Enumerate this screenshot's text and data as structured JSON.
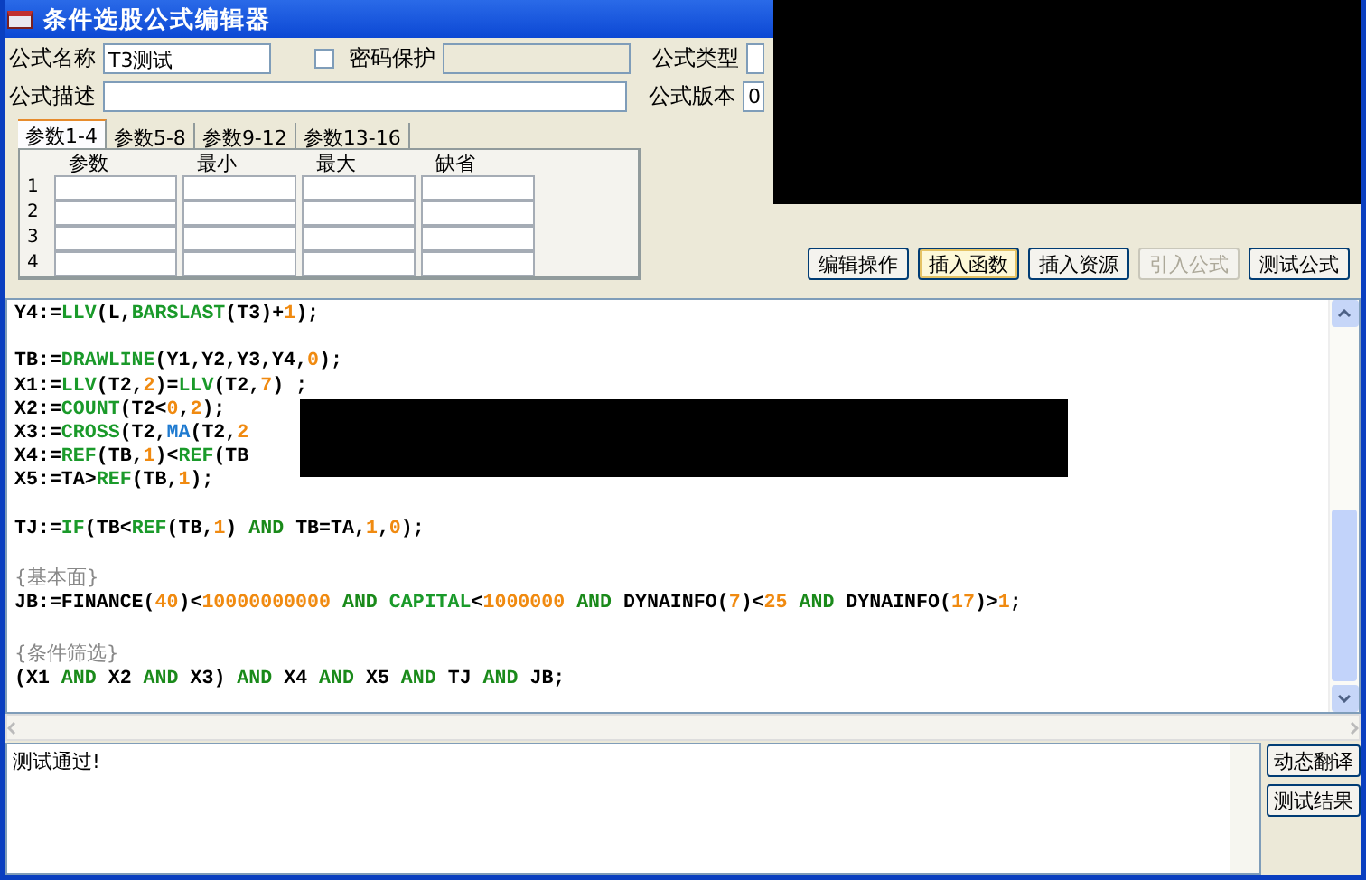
{
  "window": {
    "title": "条件选股公式编辑器"
  },
  "form": {
    "name_label": "公式名称",
    "name_value": "T3测试",
    "password": {
      "label": "密码保护",
      "checked": false
    },
    "type_label": "公式类型",
    "desc_label": "公式描述",
    "version_label": "公式版本",
    "version_value": "0"
  },
  "param_tabs": [
    {
      "label": "参数1-4",
      "selected": true
    },
    {
      "label": "参数5-8",
      "selected": false
    },
    {
      "label": "参数9-12",
      "selected": false
    },
    {
      "label": "参数13-16",
      "selected": false
    }
  ],
  "param_columns": [
    "参数",
    "最小",
    "最大",
    "缺省"
  ],
  "param_rows": [
    "1",
    "2",
    "3",
    "4"
  ],
  "toolbar": [
    {
      "label": "编辑操作",
      "focused": false,
      "disabled": false
    },
    {
      "label": "插入函数",
      "focused": true,
      "disabled": false
    },
    {
      "label": "插入资源",
      "focused": false,
      "disabled": false
    },
    {
      "label": "引入公式",
      "focused": false,
      "disabled": true
    },
    {
      "label": "测试公式",
      "focused": false,
      "disabled": false
    }
  ],
  "code_lines": [
    {
      "gap_before": false,
      "tokens": [
        {
          "kind": "text",
          "text": "Y4:="
        },
        {
          "kind": "func",
          "text": "LLV"
        },
        {
          "kind": "text",
          "text": "(L,"
        },
        {
          "kind": "func",
          "text": "BARSLAST"
        },
        {
          "kind": "text",
          "text": "(T3)+"
        },
        {
          "kind": "num",
          "text": "1"
        },
        {
          "kind": "text",
          "text": ");"
        }
      ]
    },
    {
      "gap_before": true,
      "tokens": [
        {
          "kind": "text",
          "text": "TB:="
        },
        {
          "kind": "func",
          "text": "DRAWLINE"
        },
        {
          "kind": "text",
          "text": "(Y1,Y2,Y3,Y4,"
        },
        {
          "kind": "num",
          "text": "0"
        },
        {
          "kind": "text",
          "text": ");"
        }
      ]
    },
    {
      "gap_before": false,
      "tokens": [
        {
          "kind": "text",
          "text": "X1:="
        },
        {
          "kind": "func",
          "text": "LLV"
        },
        {
          "kind": "text",
          "text": "(T2,"
        },
        {
          "kind": "num",
          "text": "2"
        },
        {
          "kind": "text",
          "text": ")="
        },
        {
          "kind": "func",
          "text": "LLV"
        },
        {
          "kind": "text",
          "text": "(T2,"
        },
        {
          "kind": "num",
          "text": "7"
        },
        {
          "kind": "text",
          "text": ") ;"
        }
      ]
    },
    {
      "gap_before": false,
      "tokens": [
        {
          "kind": "text",
          "text": "X2:="
        },
        {
          "kind": "func",
          "text": "COUNT"
        },
        {
          "kind": "text",
          "text": "(T2<"
        },
        {
          "kind": "num",
          "text": "0"
        },
        {
          "kind": "text",
          "text": ","
        },
        {
          "kind": "num",
          "text": "2"
        },
        {
          "kind": "text",
          "text": ");"
        }
      ]
    },
    {
      "gap_before": false,
      "tokens": [
        {
          "kind": "text",
          "text": "X3:="
        },
        {
          "kind": "func",
          "text": "CROSS"
        },
        {
          "kind": "text",
          "text": "(T2,"
        },
        {
          "kind": "ma",
          "text": "MA"
        },
        {
          "kind": "text",
          "text": "(T2,"
        },
        {
          "kind": "num",
          "text": "2"
        }
      ]
    },
    {
      "gap_before": false,
      "tokens": [
        {
          "kind": "text",
          "text": "X4:="
        },
        {
          "kind": "func",
          "text": "REF"
        },
        {
          "kind": "text",
          "text": "(TB,"
        },
        {
          "kind": "num",
          "text": "1"
        },
        {
          "kind": "text",
          "text": ")<"
        },
        {
          "kind": "func",
          "text": "REF"
        },
        {
          "kind": "text",
          "text": "(TB"
        }
      ]
    },
    {
      "gap_before": false,
      "tokens": [
        {
          "kind": "text",
          "text": "X5:=TA>"
        },
        {
          "kind": "func",
          "text": "REF"
        },
        {
          "kind": "text",
          "text": "(TB,"
        },
        {
          "kind": "num",
          "text": "1"
        },
        {
          "kind": "text",
          "text": ");"
        }
      ]
    },
    {
      "gap_before": true,
      "tokens": [
        {
          "kind": "text",
          "text": "TJ:="
        },
        {
          "kind": "func",
          "text": "IF"
        },
        {
          "kind": "text",
          "text": "(TB<"
        },
        {
          "kind": "func",
          "text": "REF"
        },
        {
          "kind": "text",
          "text": "(TB,"
        },
        {
          "kind": "num",
          "text": "1"
        },
        {
          "kind": "text",
          "text": ")"
        },
        {
          "kind": "kw",
          "text": " AND "
        },
        {
          "kind": "text",
          "text": "TB=TA,"
        },
        {
          "kind": "num",
          "text": "1"
        },
        {
          "kind": "text",
          "text": ","
        },
        {
          "kind": "num",
          "text": "0"
        },
        {
          "kind": "text",
          "text": ");"
        }
      ]
    },
    {
      "gap_before": true,
      "tokens": [
        {
          "kind": "comment",
          "text": "{基本面}"
        }
      ]
    },
    {
      "gap_before": false,
      "tokens": [
        {
          "kind": "text",
          "text": "JB:=FINANCE("
        },
        {
          "kind": "num",
          "text": "40"
        },
        {
          "kind": "text",
          "text": ")<"
        },
        {
          "kind": "num",
          "text": "10000000000"
        },
        {
          "kind": "kw",
          "text": " AND "
        },
        {
          "kind": "func",
          "text": "CAPITAL"
        },
        {
          "kind": "text",
          "text": "<"
        },
        {
          "kind": "num",
          "text": "1000000"
        },
        {
          "kind": "kw",
          "text": " AND "
        },
        {
          "kind": "text",
          "text": "DYNAINFO("
        },
        {
          "kind": "num",
          "text": "7"
        },
        {
          "kind": "text",
          "text": ")<"
        },
        {
          "kind": "num",
          "text": "25"
        },
        {
          "kind": "kw",
          "text": " AND "
        },
        {
          "kind": "text",
          "text": "DYNAINFO("
        },
        {
          "kind": "num",
          "text": "17"
        },
        {
          "kind": "text",
          "text": ")>"
        },
        {
          "kind": "num",
          "text": "1"
        },
        {
          "kind": "text",
          "text": ";"
        }
      ]
    },
    {
      "gap_before": true,
      "tokens": [
        {
          "kind": "comment",
          "text": "{条件筛选}"
        }
      ]
    },
    {
      "gap_before": false,
      "tokens": [
        {
          "kind": "text",
          "text": "(X1 "
        },
        {
          "kind": "kw",
          "text": "AND"
        },
        {
          "kind": "text",
          "text": " X2 "
        },
        {
          "kind": "kw",
          "text": "AND"
        },
        {
          "kind": "text",
          "text": " X3) "
        },
        {
          "kind": "kw",
          "text": "AND"
        },
        {
          "kind": "text",
          "text": " X4 "
        },
        {
          "kind": "kw",
          "text": "AND"
        },
        {
          "kind": "text",
          "text": " X5 "
        },
        {
          "kind": "kw",
          "text": "AND"
        },
        {
          "kind": "text",
          "text": " TJ "
        },
        {
          "kind": "kw",
          "text": "AND"
        },
        {
          "kind": "text",
          "text": " JB;"
        }
      ]
    }
  ],
  "output": {
    "message": "测试通过!",
    "buttons": [
      "动态翻译",
      "测试结果"
    ]
  }
}
